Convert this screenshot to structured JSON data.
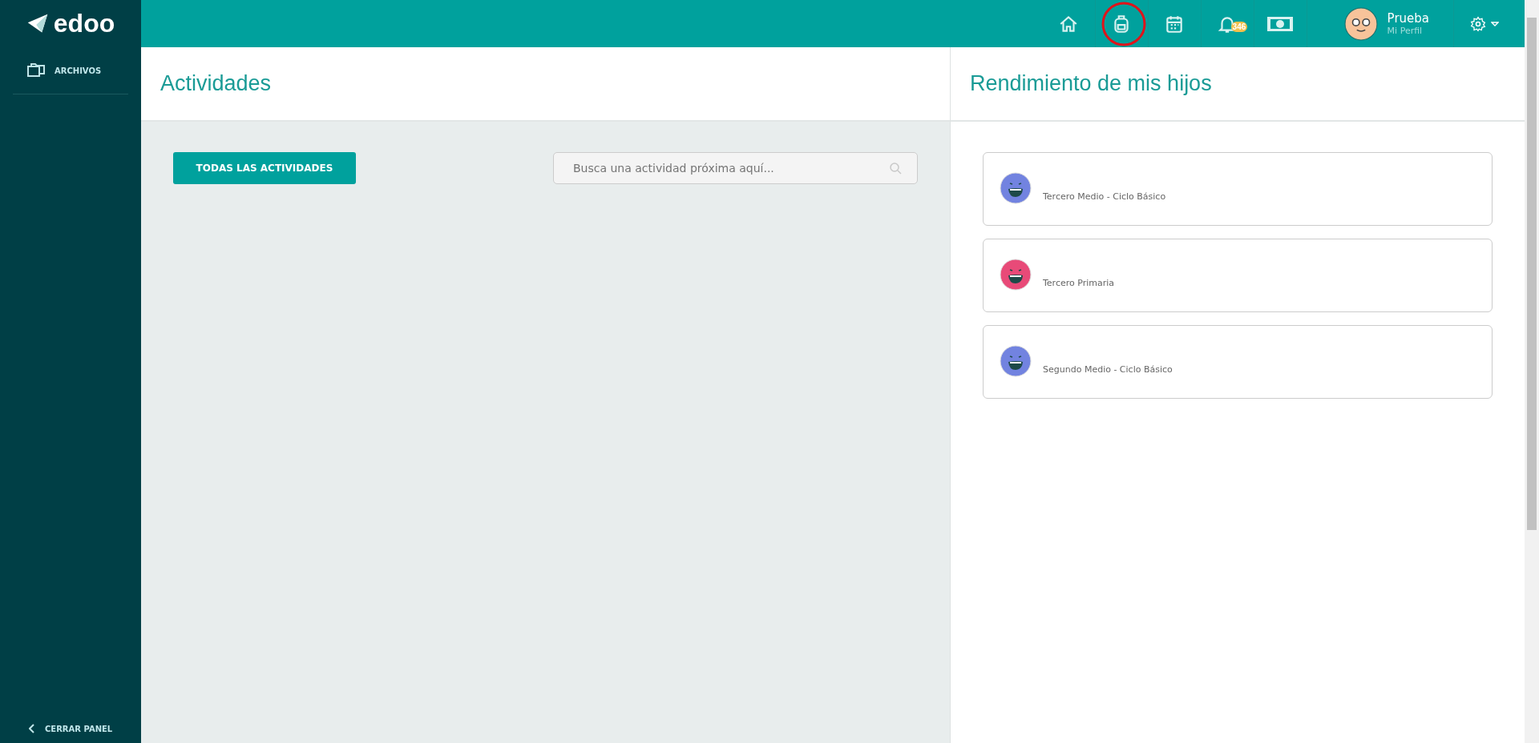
{
  "sidebar": {
    "logo": "edoo",
    "items": [
      {
        "label": "ARCHIVOS",
        "kind": "folder"
      }
    ],
    "footer": "CERRAR PANEL"
  },
  "topbar": {
    "nav": [
      {
        "kind": "home",
        "highlighted": false
      },
      {
        "kind": "backpack",
        "highlighted": true
      },
      {
        "kind": "calendar",
        "highlighted": false
      },
      {
        "kind": "bell",
        "highlighted": false,
        "badge": "346"
      },
      {
        "kind": "money",
        "highlighted": false
      }
    ],
    "user": {
      "name": "Prueba",
      "subtitle": "Mi Perfil"
    }
  },
  "activities": {
    "title": "Actividades",
    "button": "TODAS LAS ACTIVIDADES",
    "search": {
      "placeholder": "Busca una actividad próxima aquí..."
    }
  },
  "performance": {
    "title": "Rendimiento de mis hijos",
    "children": [
      {
        "grade": "Tercero Medio - Ciclo Básico",
        "color": "#7283e0"
      },
      {
        "grade": "Tercero Primaria",
        "color": "#e84a78"
      },
      {
        "grade": "Segundo Medio - Ciclo Básico",
        "color": "#7283e0"
      }
    ]
  }
}
